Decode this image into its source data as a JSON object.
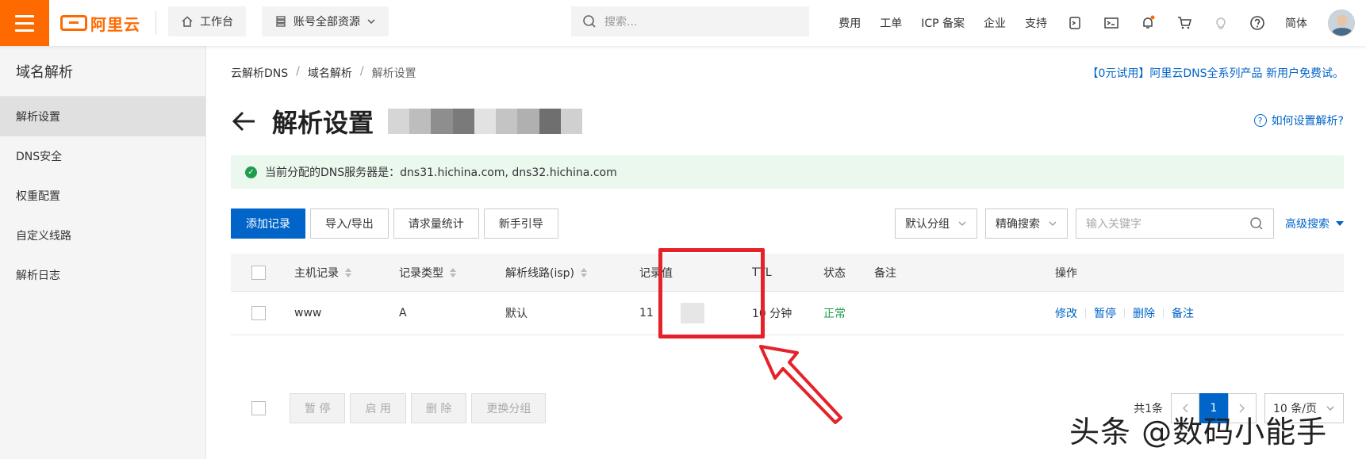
{
  "topbar": {
    "logo_text": "阿里云",
    "workbench": "工作台",
    "resources": "账号全部资源",
    "search_placeholder": "搜索...",
    "links": [
      "费用",
      "工单",
      "ICP 备案",
      "企业",
      "支持"
    ],
    "lang": "简体"
  },
  "sidebar": {
    "title": "域名解析",
    "items": [
      "解析设置",
      "DNS安全",
      "权重配置",
      "自定义线路",
      "解析日志"
    ]
  },
  "breadcrumb": [
    "云解析DNS",
    "域名解析",
    "解析设置"
  ],
  "promo": "【0元试用】阿里云DNS全系列产品 新用户免费试。",
  "page_title": "解析设置",
  "help": "如何设置解析?",
  "notice": "当前分配的DNS服务器是：dns31.hichina.com, dns32.hichina.com",
  "toolbar": {
    "add": "添加记录",
    "import_export": "导入/导出",
    "stats": "请求量统计",
    "guide": "新手引导"
  },
  "filters": {
    "group": "默认分组",
    "precise": "精确搜索",
    "keyword_placeholder": "输入关键字",
    "advanced": "高级搜索"
  },
  "table": {
    "headers": [
      "主机记录",
      "记录类型",
      "解析线路(isp)",
      "记录值",
      "TTL",
      "状态",
      "备注",
      "操作"
    ],
    "rows": [
      {
        "host": "www",
        "type": "A",
        "line": "默认",
        "value": "11",
        "ttl": "10 分钟",
        "status": "正常",
        "remark": ""
      }
    ],
    "actions": [
      "修改",
      "暂停",
      "删除",
      "备注"
    ]
  },
  "batch": [
    "暂 停",
    "启 用",
    "删 除",
    "更换分组"
  ],
  "pagination": {
    "total": "共1条",
    "current": "1",
    "per_page": "10 条/页"
  },
  "watermark": "头条 @数码小能手",
  "colors": {
    "brand": "#ff6a00",
    "primary": "#0064c8",
    "success": "#1e9d4c",
    "annotation": "#e5222a"
  }
}
